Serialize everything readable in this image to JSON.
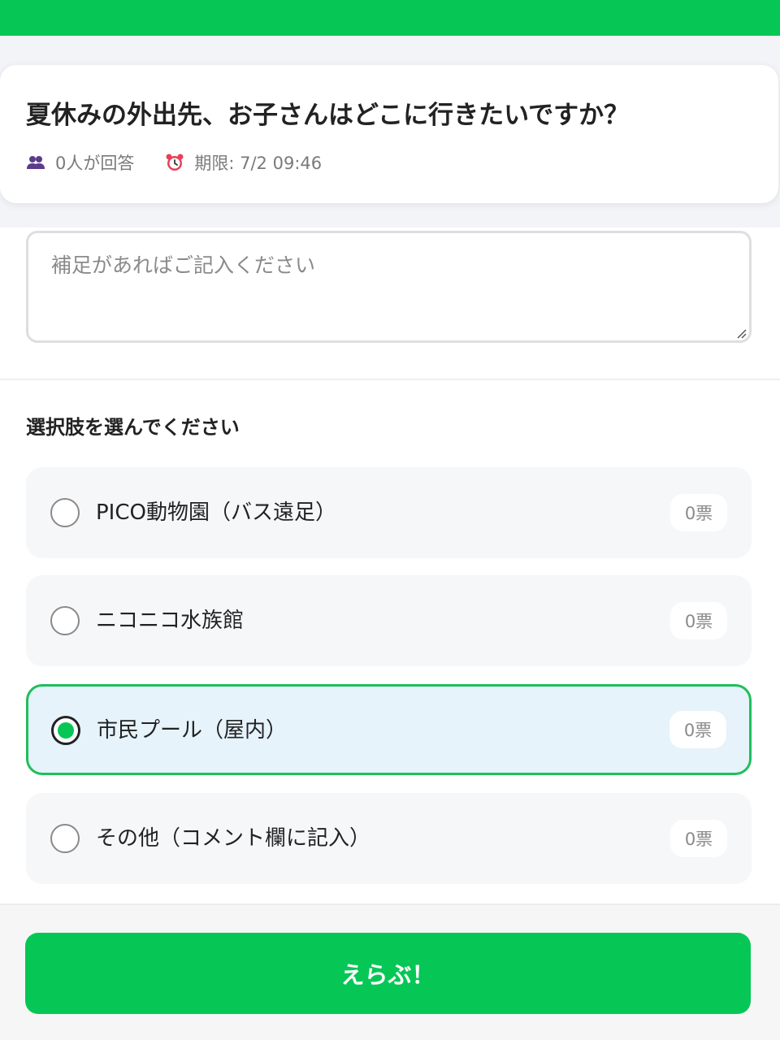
{
  "question": {
    "title": "夏休みの外出先、お子さんはどこに行きたいですか？",
    "responses": "0人が回答",
    "deadline": "期限: 7/2 09:46"
  },
  "comment": {
    "placeholder": "補足があればご記入ください",
    "value": ""
  },
  "choices": {
    "heading": "選択肢を選んでください",
    "options": [
      {
        "label": "PICO動物園（バス遠足）",
        "votes": "0票",
        "selected": false
      },
      {
        "label": "ニコニコ水族館",
        "votes": "0票",
        "selected": false
      },
      {
        "label": "市民プール（屋内）",
        "votes": "0票",
        "selected": true
      },
      {
        "label": "その他（コメント欄に記入）",
        "votes": "0票",
        "selected": false
      }
    ]
  },
  "submit": {
    "label": "えらぶ！"
  },
  "icons": {
    "responses": "people-icon",
    "deadline": "alarm-clock-icon"
  },
  "colors": {
    "brand_green": "#06c755",
    "selected_border": "#1fbf5c",
    "selected_background": "#e6f3fb"
  }
}
